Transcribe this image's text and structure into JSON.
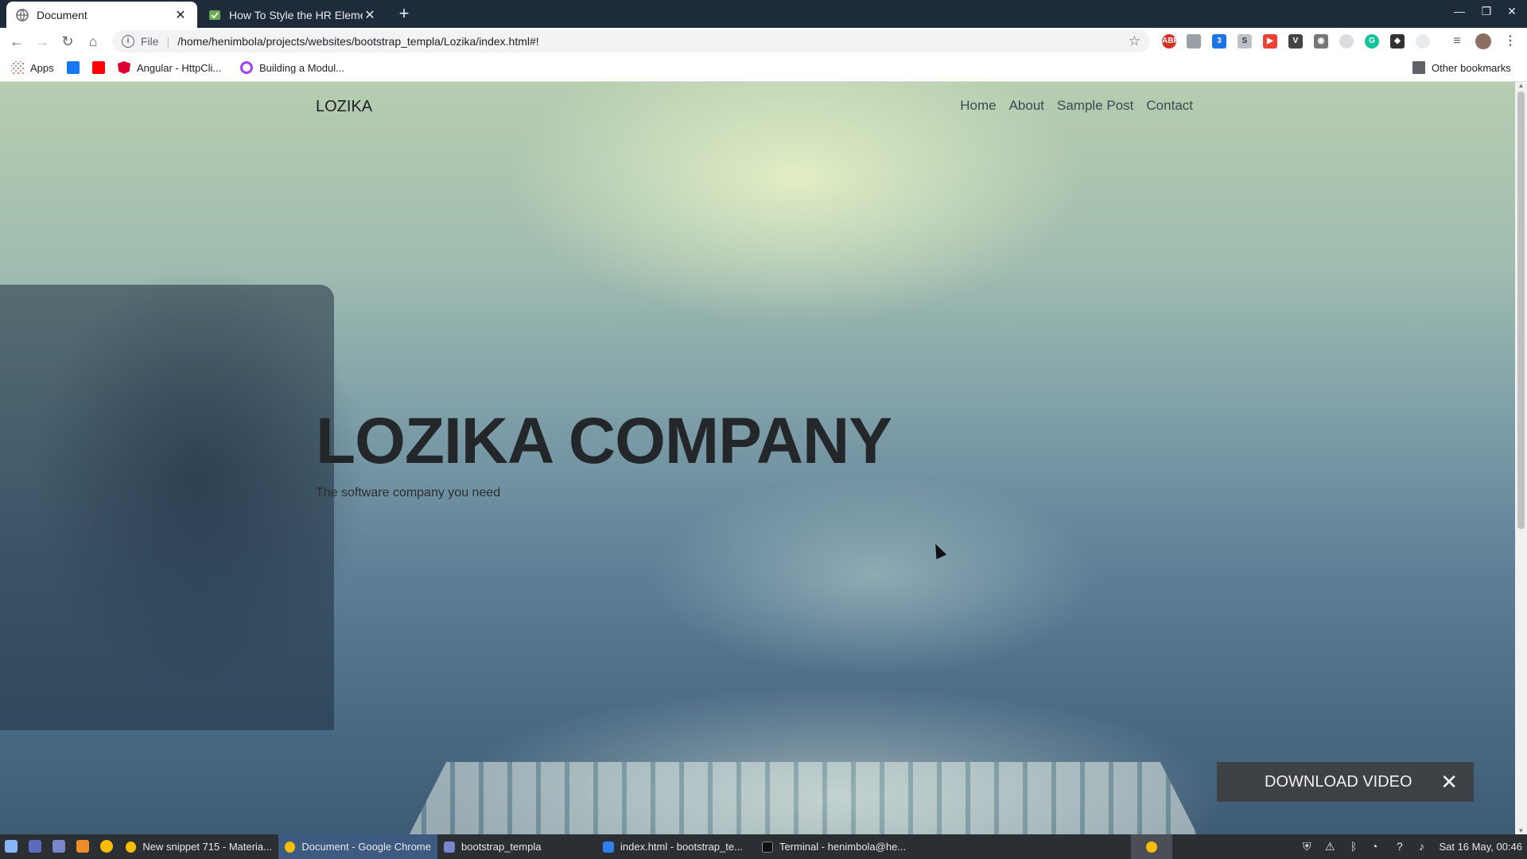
{
  "browser": {
    "tabs": [
      {
        "title": "Document",
        "active": true
      },
      {
        "title": "How To Style the HR Element",
        "active": false
      }
    ],
    "new_tab": "+",
    "url": {
      "scheme": "File",
      "path": "/home/henimbola/projects/websites/bootstrap_templa/Lozika/index.html#!"
    },
    "bookmarks": [
      {
        "label": "Apps",
        "icon": "apps-grid-icon"
      },
      {
        "label": "",
        "icon": "facebook-icon"
      },
      {
        "label": "",
        "icon": "youtube-icon"
      },
      {
        "label": "Angular - HttpCli...",
        "icon": "angular-icon"
      },
      {
        "label": "Building a Modul...",
        "icon": "circle-icon"
      },
      {
        "label": "Other bookmarks",
        "icon": "folder-icon"
      }
    ],
    "extensions": [
      "ABP",
      "",
      "3",
      "S",
      "",
      "",
      "",
      "",
      "G",
      "",
      "",
      "",
      ""
    ]
  },
  "page": {
    "brand": "LOZIKA",
    "nav": [
      "Home",
      "About",
      "Sample Post",
      "Contact"
    ],
    "hero_title": "LOZIKA COMPANY",
    "hero_subtitle": "The software company you need",
    "download_banner": {
      "label": "DOWNLOAD VIDEO",
      "close": "✕"
    }
  },
  "taskbar": {
    "tasks": [
      {
        "label": "New snippet 715 - Materia...",
        "active": false
      },
      {
        "label": "Document - Google Chrome",
        "active": true
      },
      {
        "label": "bootstrap_templa",
        "active": false
      },
      {
        "label": "index.html - bootstrap_te...",
        "active": false
      },
      {
        "label": "Terminal - henimbola@he...",
        "active": false
      }
    ],
    "clock": "Sat 16 May, 00:46"
  },
  "colors": {
    "tabstrip": "#1e2b3a",
    "taskbar": "#2b2e33",
    "active_task": "#3d5a80"
  }
}
